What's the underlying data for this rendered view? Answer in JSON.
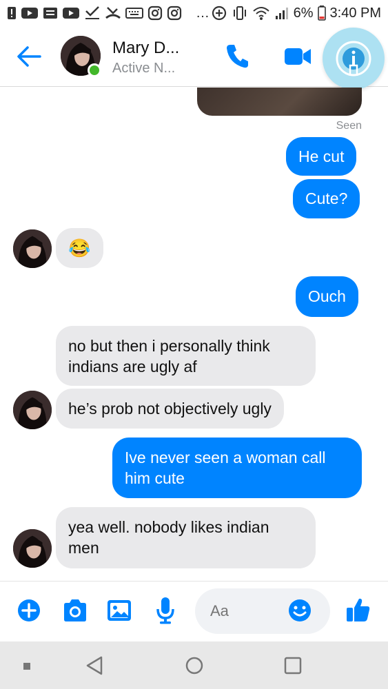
{
  "status_bar": {
    "battery": "6%",
    "time": "3:40 PM",
    "overflow": "…"
  },
  "header": {
    "name": "Mary D...",
    "status": "Active N..."
  },
  "thread": {
    "seen": "Seen",
    "messages": [
      {
        "from": "me",
        "text": "He cut"
      },
      {
        "from": "me",
        "text": "Cute?"
      },
      {
        "from": "them",
        "text": "😂"
      },
      {
        "from": "me",
        "text": "Ouch"
      },
      {
        "from": "them",
        "text": "no but then i personally think indians are ugly af"
      },
      {
        "from": "them",
        "text": "he’s prob not objectively ugly"
      },
      {
        "from": "me",
        "text": "Ive never seen a woman call him cute"
      },
      {
        "from": "them",
        "text": "yea well. nobody likes indian men"
      }
    ]
  },
  "composer": {
    "placeholder": "Aa"
  },
  "colors": {
    "accent": "#0084ff",
    "incoming_bubble": "#e9e9eb",
    "active": "#42b72a"
  },
  "icons": [
    "back-arrow-icon",
    "phone-icon",
    "video-icon",
    "info-icon",
    "plus-icon",
    "camera-icon",
    "gallery-icon",
    "microphone-icon",
    "emoji-icon",
    "like-icon"
  ]
}
